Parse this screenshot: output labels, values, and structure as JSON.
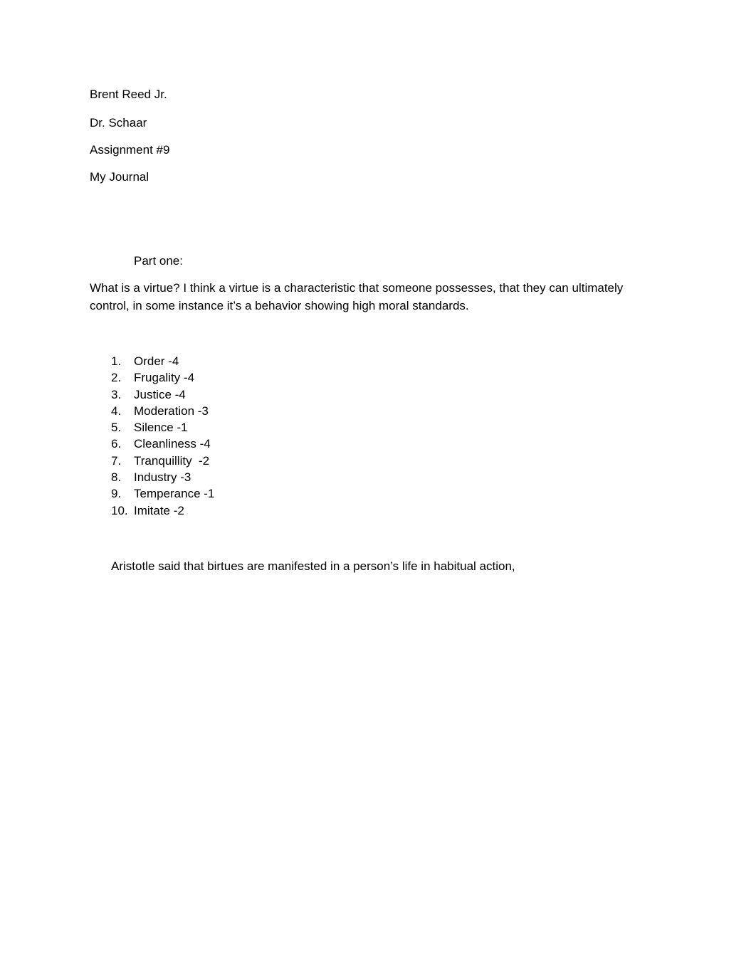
{
  "header": {
    "author": "Brent Reed Jr.",
    "instructor": "Dr. Schaar",
    "assignment": "Assignment #9",
    "title": "My Journal"
  },
  "part_one": {
    "heading": "Part one:",
    "paragraph": "What is a virtue? I think a virtue is a characteristic that someone possesses, that they can ultimately control, in some instance it’s a behavior showing high moral standards."
  },
  "virtues": [
    {
      "number": "1.",
      "text": "Order -4"
    },
    {
      "number": "2.",
      "text": "Frugality -4"
    },
    {
      "number": "3.",
      "text": "Justice -4"
    },
    {
      "number": "4.",
      "text": "Moderation -3"
    },
    {
      "number": "5.",
      "text": "Silence -1"
    },
    {
      "number": "6.",
      "text": "Cleanliness -4"
    },
    {
      "number": "7.",
      "text": "Tranquillity  -2"
    },
    {
      "number": "8.",
      "text": "Industry -3"
    },
    {
      "number": "9.",
      "text": "Temperance -1"
    },
    {
      "number": "10.",
      "text": "Imitate -2"
    }
  ],
  "closing": {
    "paragraph": "Aristotle said that birtues are manifested in a person’s life in habitual action,"
  }
}
